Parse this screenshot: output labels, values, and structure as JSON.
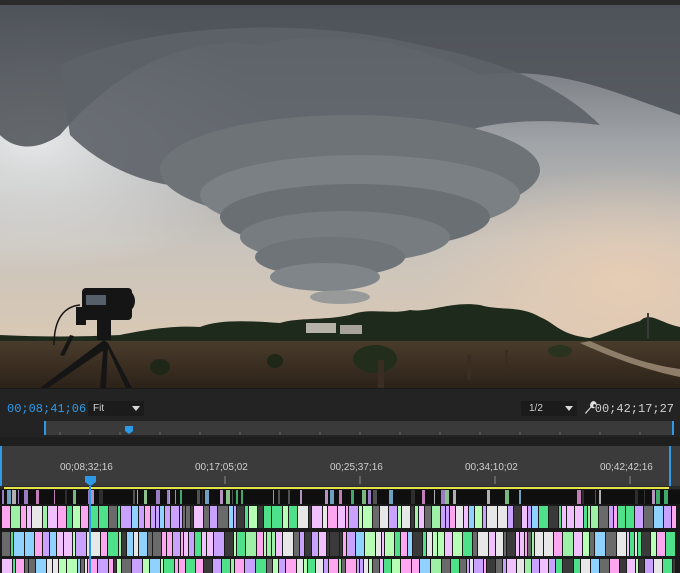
{
  "monitor": {
    "current_timecode": "00;08;41;06",
    "zoom_select": "Fit",
    "resolution_select": "1/2",
    "duration_timecode": "00;42;17;27"
  },
  "ruler": {
    "labels": [
      "00;08;32;16",
      "00;17;05;02",
      "00;25;37;16",
      "00;34;10;02",
      "00;42;42;16"
    ]
  },
  "icons": {
    "settings": "wrench-icon",
    "playhead": "playhead-icon"
  },
  "colors": {
    "accent": "#2d9ae8",
    "timecode_current": "#2d9ae8",
    "ruler_bg": "#3b3b3b"
  }
}
